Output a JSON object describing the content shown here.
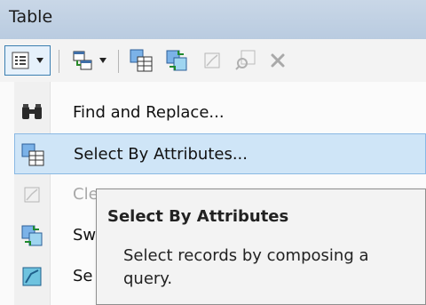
{
  "window": {
    "title": "Table"
  },
  "toolbar": {
    "buttons": [
      {
        "icon": "table-options-icon"
      },
      {
        "icon": "related-tables-icon"
      },
      {
        "icon": "select-by-attributes-icon"
      },
      {
        "icon": "switch-selection-icon"
      },
      {
        "icon": "clear-selection-icon"
      },
      {
        "icon": "zoom-to-selected-icon"
      },
      {
        "icon": "delete-selected-icon"
      }
    ]
  },
  "menu": {
    "items": [
      {
        "label": "Find and Replace...",
        "icon": "binoculars-icon"
      },
      {
        "label": "Select By Attributes...",
        "icon": "select-by-attributes-icon",
        "highlighted": true
      },
      {
        "label": "Cle",
        "icon": "clear-selection-icon",
        "disabled": true
      },
      {
        "label": "Sw",
        "icon": "switch-selection-icon"
      },
      {
        "label": "Se",
        "icon": "select-all-icon"
      }
    ]
  },
  "tooltip": {
    "title": "Select By Attributes",
    "body": "Select records by composing a query."
  },
  "colors": {
    "highlight": "#cfe5f7",
    "highlight_border": "#8ab9e3",
    "titlebar": "#c4d4e6"
  }
}
